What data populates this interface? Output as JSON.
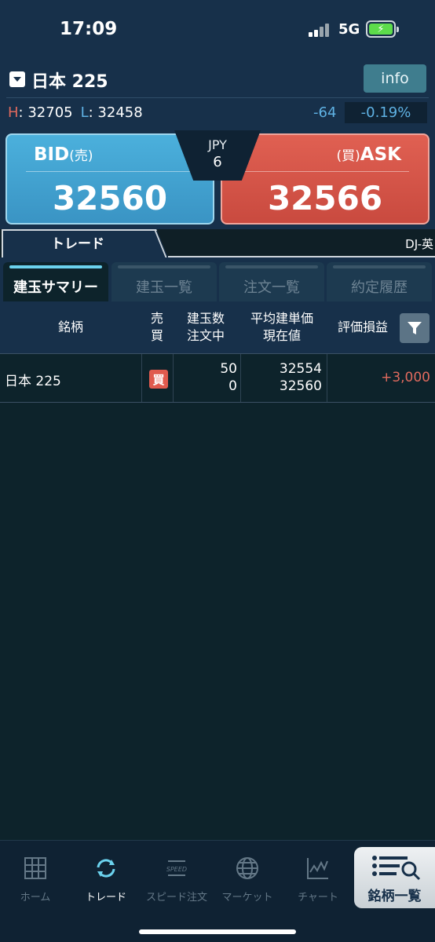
{
  "status_bar": {
    "time": "17:09",
    "network": "5G"
  },
  "header": {
    "symbol": "日本 225",
    "info_label": "info"
  },
  "high_low": {
    "h_label": "H",
    "h_value": ": 32705",
    "l_label": "L",
    "l_value": ": 32458",
    "change": "-64",
    "change_pct": "-0.19%"
  },
  "quote": {
    "bid_label": "BID",
    "bid_sub": "(売)",
    "bid_price": "32560",
    "ask_label": "ASK",
    "ask_sub": "(買)",
    "ask_price": "32566",
    "spread_currency": "JPY",
    "spread_value": "6"
  },
  "tabs": {
    "trade": "トレード",
    "right_symbol": "DJ-英"
  },
  "sub_tabs": [
    "建玉サマリー",
    "建玉一覧",
    "注文一覧",
    "約定履歴"
  ],
  "table": {
    "headers": {
      "symbol": "銘柄",
      "side_top": "売",
      "side_bottom": "買",
      "qty_top": "建玉数",
      "qty_bottom": "注文中",
      "price_top": "平均建単価",
      "price_bottom": "現在値",
      "pl": "評価損益"
    },
    "rows": [
      {
        "symbol": "日本 225",
        "side": "買",
        "qty": "50",
        "ordering": "0",
        "avg_price": "32554",
        "current_price": "32560",
        "pl": "+3,000"
      }
    ]
  },
  "bottom_nav": [
    {
      "label": "ホーム",
      "icon": "grid-icon"
    },
    {
      "label": "トレード",
      "icon": "refresh-arrows-icon"
    },
    {
      "label": "スピード注文",
      "icon": "speed-icon"
    },
    {
      "label": "マーケット",
      "icon": "globe-icon"
    },
    {
      "label": "チャート",
      "icon": "chart-icon"
    },
    {
      "label": "銘柄一覧",
      "icon": "list-search-icon"
    }
  ],
  "colors": {
    "bid": "#4bb0dc",
    "ask": "#e06052",
    "accent": "#6bd2ee",
    "profit": "#e06a5e"
  }
}
